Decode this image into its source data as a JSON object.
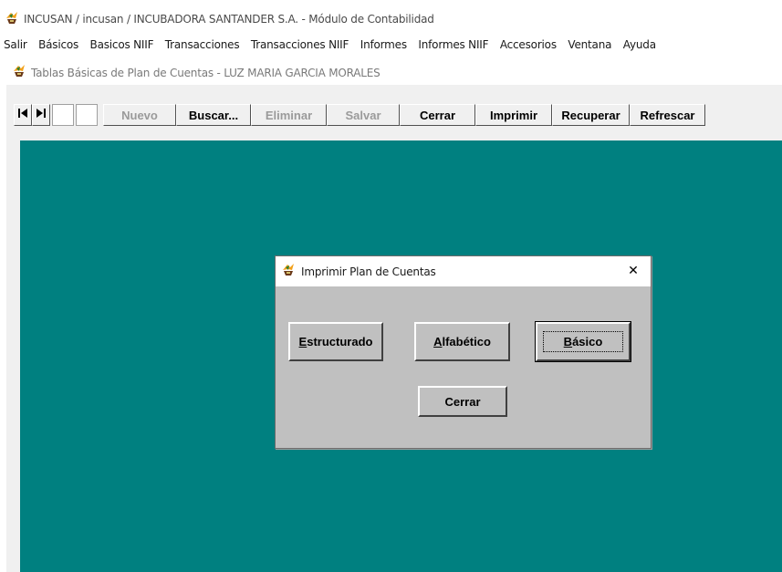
{
  "app": {
    "title": "INCUSAN / incusan / INCUBADORA SANTANDER S.A. - Módulo de Contabilidad",
    "icon": "app-logo-icon"
  },
  "menu": {
    "items": [
      "Salir",
      "Básicos",
      "Basicos NIIF",
      "Transacciones",
      "Transacciones NIIF",
      "Informes",
      "Informes NIIF",
      "Accesorios",
      "Ventana",
      "Ayuda"
    ]
  },
  "child_window": {
    "title": "Tablas Básicas de Plan de Cuentas - LUZ MARIA GARCIA MORALES",
    "toolbar": {
      "nuevo": "Nuevo",
      "buscar": "Buscar...",
      "eliminar": "Eliminar",
      "salvar": "Salvar",
      "cerrar": "Cerrar",
      "imprimir": "Imprimir",
      "recuperar": "Recuperar",
      "refrescar": "Refrescar"
    },
    "client_color": "#008080"
  },
  "dialog": {
    "title": "Imprimir Plan de Cuentas",
    "close_glyph": "✕",
    "estructurado": {
      "first": "E",
      "rest": "structurado"
    },
    "alfabetico": {
      "first": "A",
      "rest": "lfabético"
    },
    "basico": {
      "first": "B",
      "rest": "ásico"
    },
    "cerrar": "Cerrar"
  }
}
